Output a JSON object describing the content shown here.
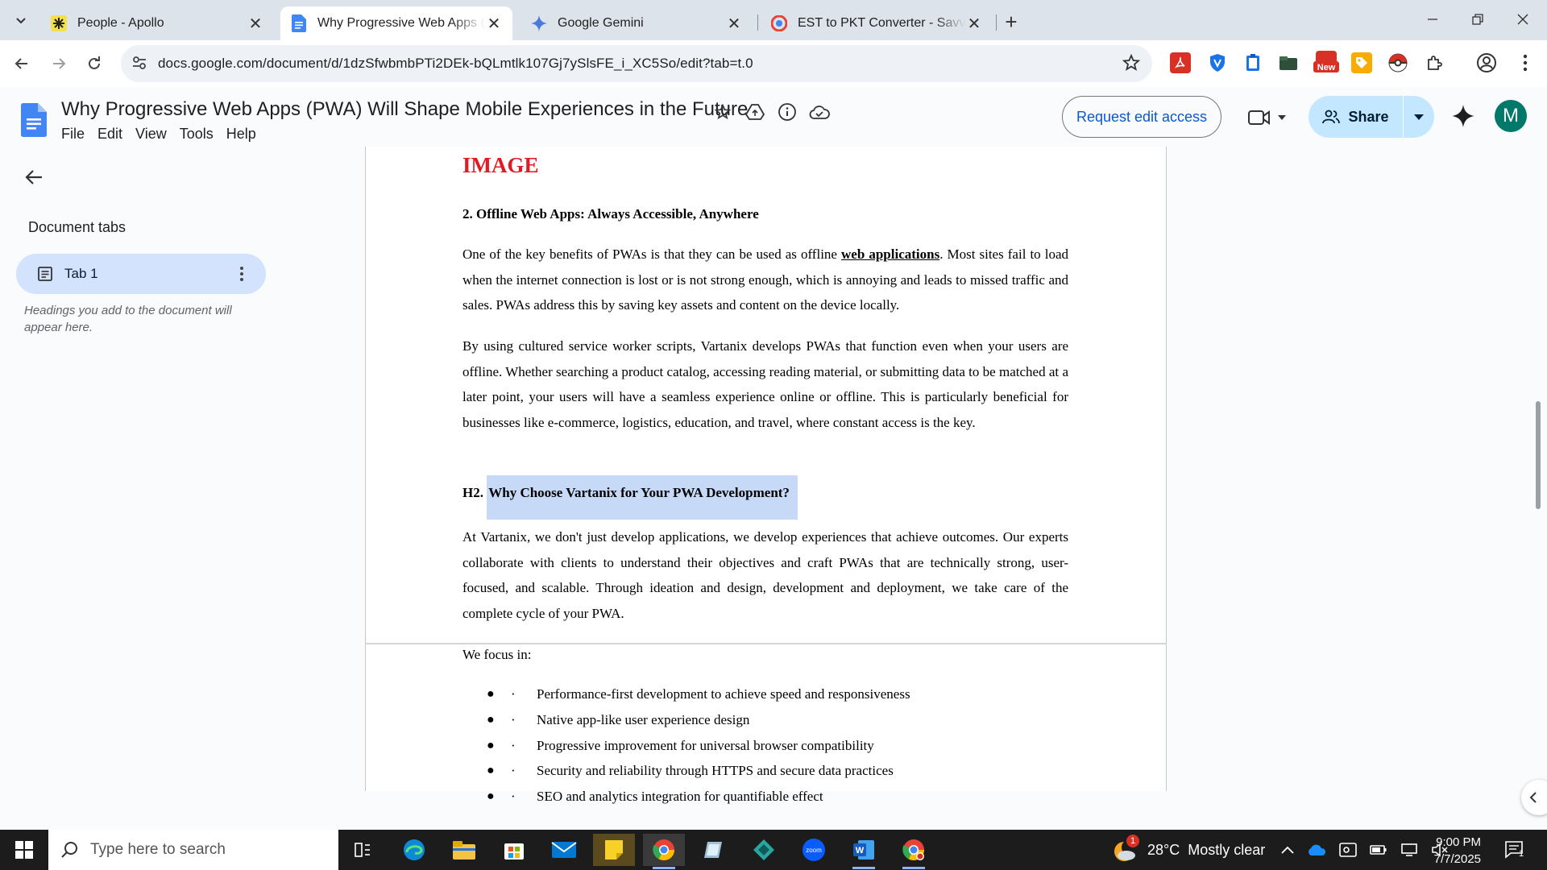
{
  "browser": {
    "tabs": [
      {
        "title": "People - Apollo",
        "icon": "apollo-icon"
      },
      {
        "title": "Why Progressive Web Apps (PW",
        "icon": "google-docs-icon",
        "active": true
      },
      {
        "title": "Google Gemini",
        "icon": "gemini-icon"
      },
      {
        "title": "EST to PKT Converter - Savvy Ti",
        "icon": "savvy-time-icon"
      }
    ],
    "url": "docs.google.com/document/d/1dzSfwbmbPTi2DEk-bQLmtlk107Gj7ySlsFE_i_XC5So/edit?tab=t.0",
    "extensions": [
      {
        "name": "pdf-extension-icon",
        "color": "#d93025",
        "label": ""
      },
      {
        "name": "shield-extension-icon",
        "color": "#1a73e8",
        "label": ""
      },
      {
        "name": "clipboard-extension-icon",
        "color": "#1a73e8",
        "label": ""
      },
      {
        "name": "folder-extension-icon",
        "color": "#2f5f3a",
        "label": ""
      },
      {
        "name": "new-extension-icon",
        "color": "#d93025",
        "label": "New"
      },
      {
        "name": "tag-extension-icon",
        "color": "#f9ab00",
        "label": ""
      },
      {
        "name": "pokeball-extension-icon",
        "color": "#d93025",
        "label": ""
      }
    ]
  },
  "docs": {
    "title": "Why Progressive Web Apps (PWA) Will Shape Mobile Experiences in the Future",
    "menu": [
      "File",
      "Edit",
      "View",
      "Tools",
      "Help"
    ],
    "request_edit": "Request edit access",
    "share": "Share",
    "avatar_initial": "M"
  },
  "sidebar": {
    "heading": "Document tabs",
    "tab_label": "Tab 1",
    "hint": "Headings you add to the document will appear here."
  },
  "document": {
    "image_label": "IMAGE",
    "section2_heading": "2. Offline Web Apps: Always Accessible, Anywhere",
    "p1_before": "One of the key benefits of PWAs is that they can be used as offline ",
    "p1_link": "web applications",
    "p1_after": ". Most sites fail to load when the internet connection is lost or is not strong enough, which is annoying and leads to missed traffic and sales. PWAs address this by saving key assets and content on the device locally.",
    "p2": "By using cultured service worker scripts, Vartanix develops PWAs that function even when your users are offline. Whether searching a product catalog, accessing reading material, or submitting data to be matched at a later point, your users will have a seamless experience online or offline. This is particularly beneficial for businesses like e-commerce, logistics, education, and travel, where constant access is the key.",
    "h2_prefix": "H2. ",
    "h2_selected": "Why Choose Vartanix for Your PWA Development?",
    "p3": "At Vartanix, we don't just develop applications, we develop experiences that achieve outcomes. Our experts collaborate with clients to understand their objectives and craft PWAs that are technically strong, user-focused, and scalable. Through ideation and design, development and deployment, we take care of the complete cycle of your PWA.",
    "focus_intro": "We focus in:",
    "bullets": [
      "Performance-first development to achieve speed and responsiveness",
      "Native app-like user experience design",
      "Progressive improvement for universal browser compatibility",
      "Security and reliability through HTTPS and secure data practices",
      "SEO and analytics integration for quantifiable effect"
    ],
    "bullet_glyph": "●",
    "bullet_dot": "·"
  },
  "taskbar": {
    "search_placeholder": "Type here to search",
    "weather_temp": "28°C",
    "weather_desc": "Mostly clear",
    "weather_badge": "1",
    "time": "9:00 PM",
    "date": "7/7/2025",
    "notif_count": "1"
  }
}
